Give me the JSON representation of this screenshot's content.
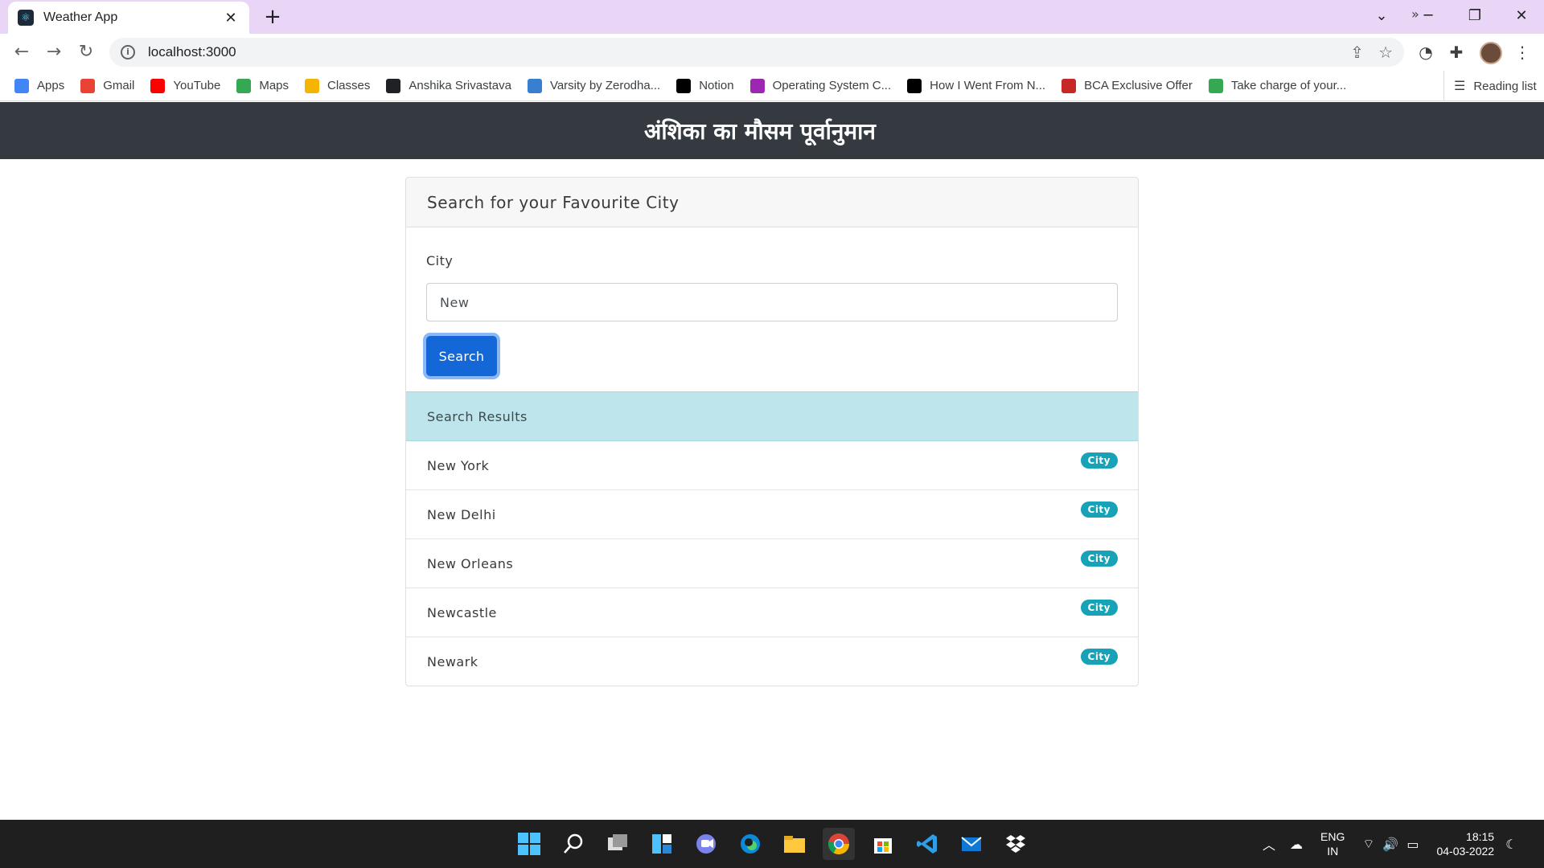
{
  "browser": {
    "tab_title": "Weather App",
    "url": "localhost:3000",
    "bookmarks": [
      {
        "label": "Apps",
        "icon": "apps-grid-icon",
        "color": "#4285f4"
      },
      {
        "label": "Gmail",
        "icon": "gmail-icon",
        "color": "#ea4335"
      },
      {
        "label": "YouTube",
        "icon": "youtube-icon",
        "color": "#ff0000"
      },
      {
        "label": "Maps",
        "icon": "maps-icon",
        "color": "#34a853"
      },
      {
        "label": "Classes",
        "icon": "classroom-icon",
        "color": "#f4b400"
      },
      {
        "label": "Anshika Srivastava",
        "icon": "globe-icon",
        "color": "#202124"
      },
      {
        "label": "Varsity by Zerodha...",
        "icon": "varsity-icon",
        "color": "#387ed1"
      },
      {
        "label": "Notion",
        "icon": "notion-icon",
        "color": "#000000"
      },
      {
        "label": "Operating System C...",
        "icon": "m-icon",
        "color": "#9c27b0"
      },
      {
        "label": "How I Went From N...",
        "icon": "medium-icon",
        "color": "#000000"
      },
      {
        "label": "BCA Exclusive Offer",
        "icon": "bca-icon",
        "color": "#c62828"
      },
      {
        "label": "Take charge of your...",
        "icon": "google-drive-icon",
        "color": "#34a853"
      }
    ],
    "more_bookmarks": "»",
    "reading_list": "Reading list"
  },
  "app": {
    "title": "अंशिका का मौसम पूर्वानुमान",
    "card_header": "Search for your Favourite City",
    "city_label": "City",
    "city_value": "New",
    "search_button": "Search",
    "results_header": "Search Results",
    "results": [
      {
        "name": "New York",
        "badge": "City"
      },
      {
        "name": "New Delhi",
        "badge": "City"
      },
      {
        "name": "New Orleans",
        "badge": "City"
      },
      {
        "name": "Newcastle",
        "badge": "City"
      },
      {
        "name": "Newark",
        "badge": "City"
      }
    ]
  },
  "taskbar": {
    "lang_top": "ENG",
    "lang_bottom": "IN",
    "time": "18:15",
    "date": "04-03-2022"
  },
  "colors": {
    "header_bg": "#343a40",
    "primary": "#1467d6",
    "info_bg": "#bee5eb",
    "badge": "#17a2b8"
  }
}
